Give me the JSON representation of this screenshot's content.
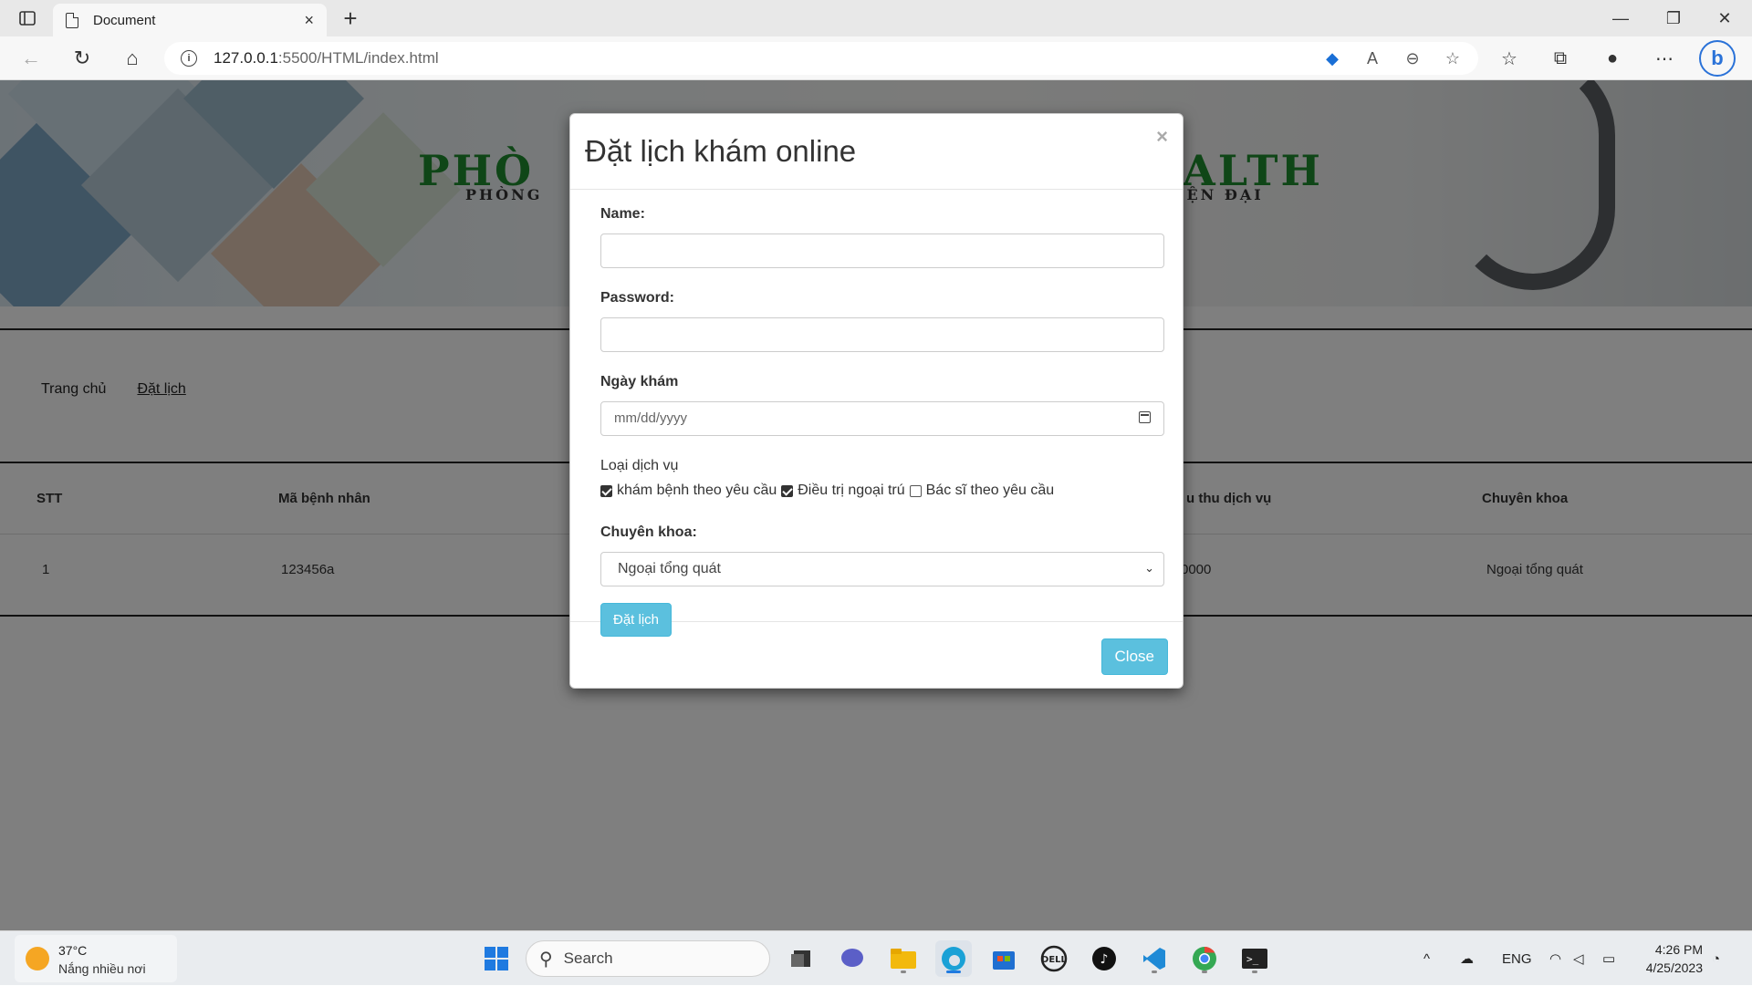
{
  "browser": {
    "tab_title": "Document",
    "tab_close": "×",
    "new_tab": "+",
    "url_host": "127.0.0.1",
    "url_rest": ":5500/HTML/index.html",
    "window_min": "—",
    "window_max": "❐",
    "window_close": "✕"
  },
  "banner": {
    "brand_left": "PHÒ",
    "brand_right": "ALTH",
    "sub_left": "PHÒNG",
    "sub_right": "IỆN ĐẠI"
  },
  "nav": {
    "home": "Trang chủ",
    "booking": "Đặt lịch"
  },
  "table": {
    "headers": [
      "STT",
      "Mã bệnh nhân",
      "u thu dịch vụ",
      "Chuyên khoa"
    ],
    "rows": [
      [
        "1",
        "123456a",
        "0000",
        "Ngoại tổng quát"
      ]
    ]
  },
  "modal": {
    "title": "Đặt lịch khám online",
    "close_x": "×",
    "name_label": "Name:",
    "name_value": "",
    "password_label": "Password:",
    "password_value": "",
    "date_label": "Ngày khám",
    "date_placeholder": "mm/dd/yyyy",
    "service_label": "Loại dịch vụ",
    "services": [
      {
        "label": "khám bệnh theo yêu cầu",
        "checked": true
      },
      {
        "label": "Điều trị ngoại trú",
        "checked": true
      },
      {
        "label": "Bác sĩ theo yêu cầu",
        "checked": false
      }
    ],
    "specialty_label": "Chuyên khoa:",
    "specialty_selected": "Ngoại tổng quát",
    "submit_label": "Đặt lịch",
    "close_label": "Close"
  },
  "taskbar": {
    "temp": "37°C",
    "weather": "Nắng nhiều nơi",
    "search_placeholder": "Search",
    "lang": "ENG",
    "time": "4:26 PM",
    "date": "4/25/2023"
  },
  "colors": {
    "accent": "#5bc0de",
    "brand_green": "#1e8d2e"
  }
}
